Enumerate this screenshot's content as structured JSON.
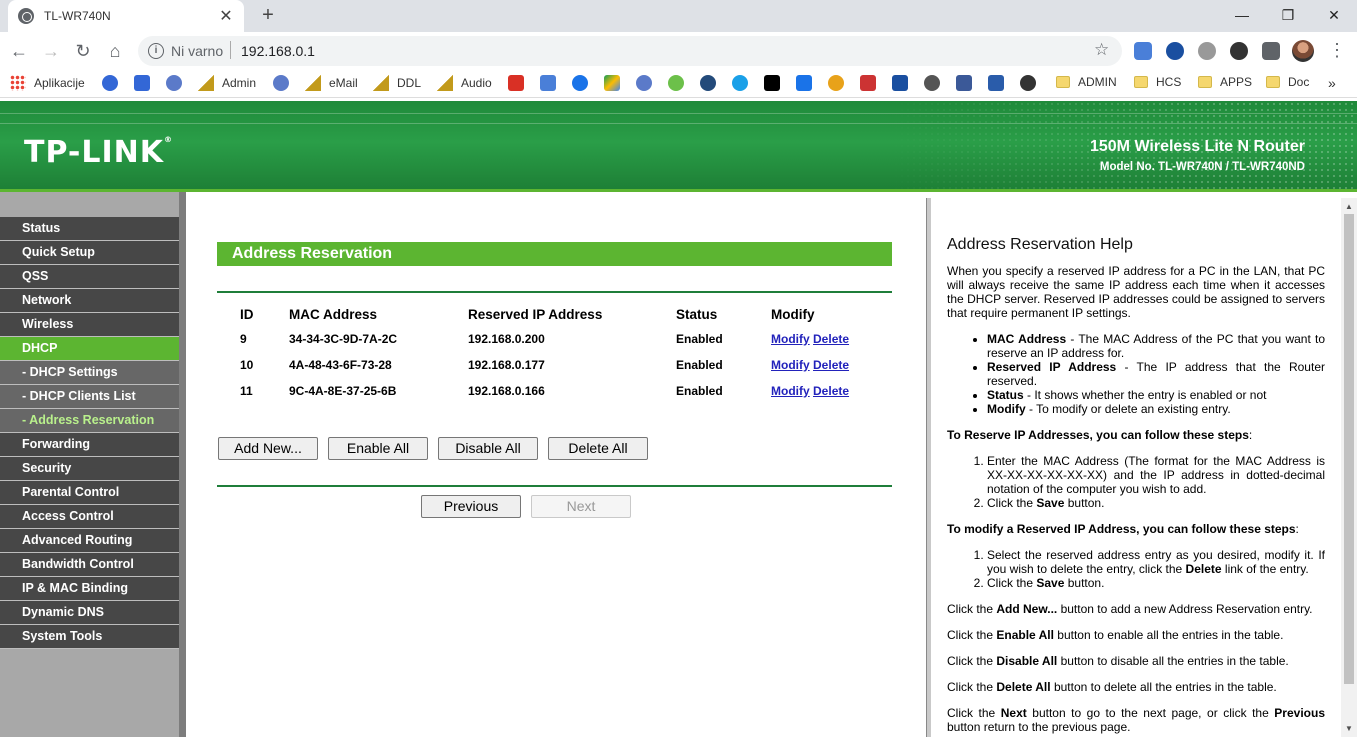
{
  "browser": {
    "tab_title": "TL-WR740N",
    "new_tab": "+",
    "tab_close": "✕",
    "window_controls": {
      "minimize": "—",
      "maximize": "❐",
      "close": "✕"
    },
    "nav": {
      "back": "←",
      "forward": "→",
      "reload": "↻",
      "home": "⌂"
    },
    "security_label": "Ni varno",
    "url": "192.168.0.1",
    "info_glyph": "i",
    "bookmark_glyph": "☆",
    "menu_glyph": "⋮",
    "bookmarks": [
      {
        "label": "Aplikacije"
      },
      {
        "label": "Admin"
      },
      {
        "label": "eMail"
      },
      {
        "label": "DDL"
      },
      {
        "label": "Audio"
      },
      {
        "label": "ADMIN"
      },
      {
        "label": "HCS"
      },
      {
        "label": "APPS"
      },
      {
        "label": "Doc"
      }
    ],
    "bookmarks_more": "»"
  },
  "header": {
    "logo": "TP-LINK",
    "logo_mark": "®",
    "product_name": "150M Wireless Lite N Router",
    "model": "Model No. TL-WR740N / TL-WR740ND"
  },
  "menu": [
    {
      "label": "Status"
    },
    {
      "label": "Quick Setup"
    },
    {
      "label": "QSS"
    },
    {
      "label": "Network"
    },
    {
      "label": "Wireless"
    },
    {
      "label": "DHCP"
    },
    {
      "label": "- DHCP Settings"
    },
    {
      "label": "- DHCP Clients List"
    },
    {
      "label": "- Address Reservation"
    },
    {
      "label": "Forwarding"
    },
    {
      "label": "Security"
    },
    {
      "label": "Parental Control"
    },
    {
      "label": "Access Control"
    },
    {
      "label": "Advanced Routing"
    },
    {
      "label": "Bandwidth Control"
    },
    {
      "label": "IP & MAC Binding"
    },
    {
      "label": "Dynamic DNS"
    },
    {
      "label": "System Tools"
    }
  ],
  "main": {
    "title": "Address Reservation",
    "columns": [
      "ID",
      "MAC Address",
      "Reserved IP Address",
      "Status",
      "Modify"
    ],
    "rows": [
      {
        "id": "9",
        "mac": "34-34-3C-9D-7A-2C",
        "ip": "192.168.0.200",
        "status": "Enabled",
        "modify": "Modify",
        "delete": "Delete"
      },
      {
        "id": "10",
        "mac": "4A-48-43-6F-73-28",
        "ip": "192.168.0.177",
        "status": "Enabled",
        "modify": "Modify",
        "delete": "Delete"
      },
      {
        "id": "11",
        "mac": "9C-4A-8E-37-25-6B",
        "ip": "192.168.0.166",
        "status": "Enabled",
        "modify": "Modify",
        "delete": "Delete"
      }
    ],
    "buttons": {
      "add_new": "Add New...",
      "enable_all": "Enable All",
      "disable_all": "Disable All",
      "delete_all": "Delete All",
      "previous": "Previous",
      "next": "Next"
    }
  },
  "help": {
    "title": "Address Reservation Help",
    "intro": "When you specify a reserved IP address for a PC in the LAN, that PC will always receive the same IP address each time when it accesses the DHCP server. Reserved IP addresses could be assigned to servers that require permanent IP settings.",
    "defs": [
      {
        "term": "MAC Address",
        "text": " - The MAC Address of the PC that you want to reserve an IP address for."
      },
      {
        "term": "Reserved IP Address",
        "text": " - The IP address that the Router reserved."
      },
      {
        "term": "Status",
        "text": " - It shows whether the entry is enabled or not"
      },
      {
        "term": "Modify",
        "text": " - To modify or delete an existing entry."
      }
    ],
    "reserve_heading": "To Reserve IP Addresses, you can follow these steps",
    "reserve_steps": [
      "Enter the MAC Address (The format for the MAC Address is XX-XX-XX-XX-XX-XX) and the IP address in dotted-decimal notation of the computer you wish to add.",
      "Click the Save button."
    ],
    "modify_heading": "To modify a Reserved IP Address, you can follow these steps",
    "modify_steps": [
      "Select the reserved address entry as you desired, modify it. If you wish to delete the entry, click the Delete link of the entry.",
      "Click the Save button."
    ],
    "notes": [
      "Click the Add New... button to add a new Address Reservation entry.",
      "Click the Enable All button to enable all the entries in the table.",
      "Click the Disable All button to disable all the entries in the table.",
      "Click the Delete All button to delete all the entries in the table.",
      "Click the Next button to go to the next page, or click the Previous button return to the previous page."
    ]
  },
  "colors": {
    "brand_green": "#5cb531",
    "menu_bg": "#474747",
    "link": "#2222bb"
  }
}
